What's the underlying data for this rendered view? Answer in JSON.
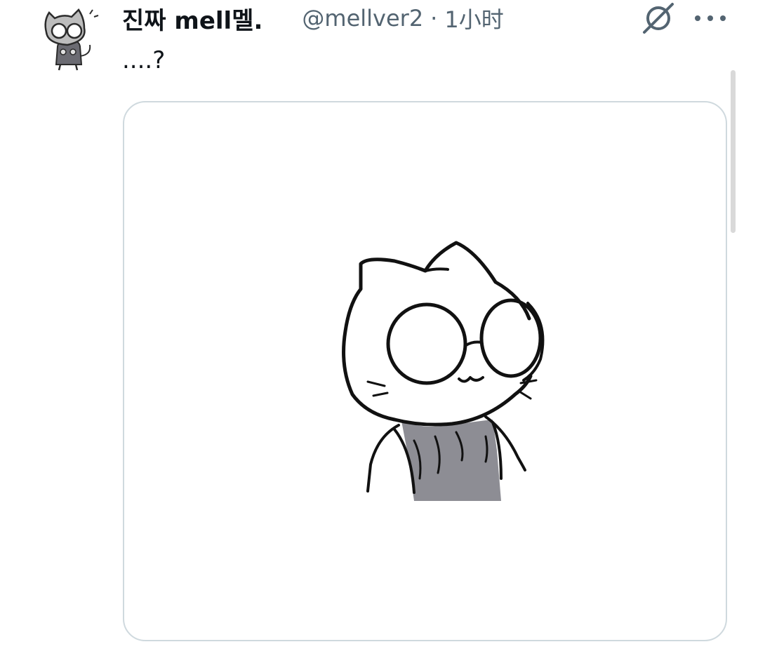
{
  "post": {
    "display_name": "진짜 mell멜.",
    "handle": "@mellver2",
    "separator": "·",
    "timestamp": "1小时",
    "text": "....?"
  },
  "icons": {
    "grok": "grok-icon",
    "more": "more-icon"
  },
  "colors": {
    "text_primary": "#0f1419",
    "text_secondary": "#536471",
    "card_border": "#cfd9de"
  }
}
